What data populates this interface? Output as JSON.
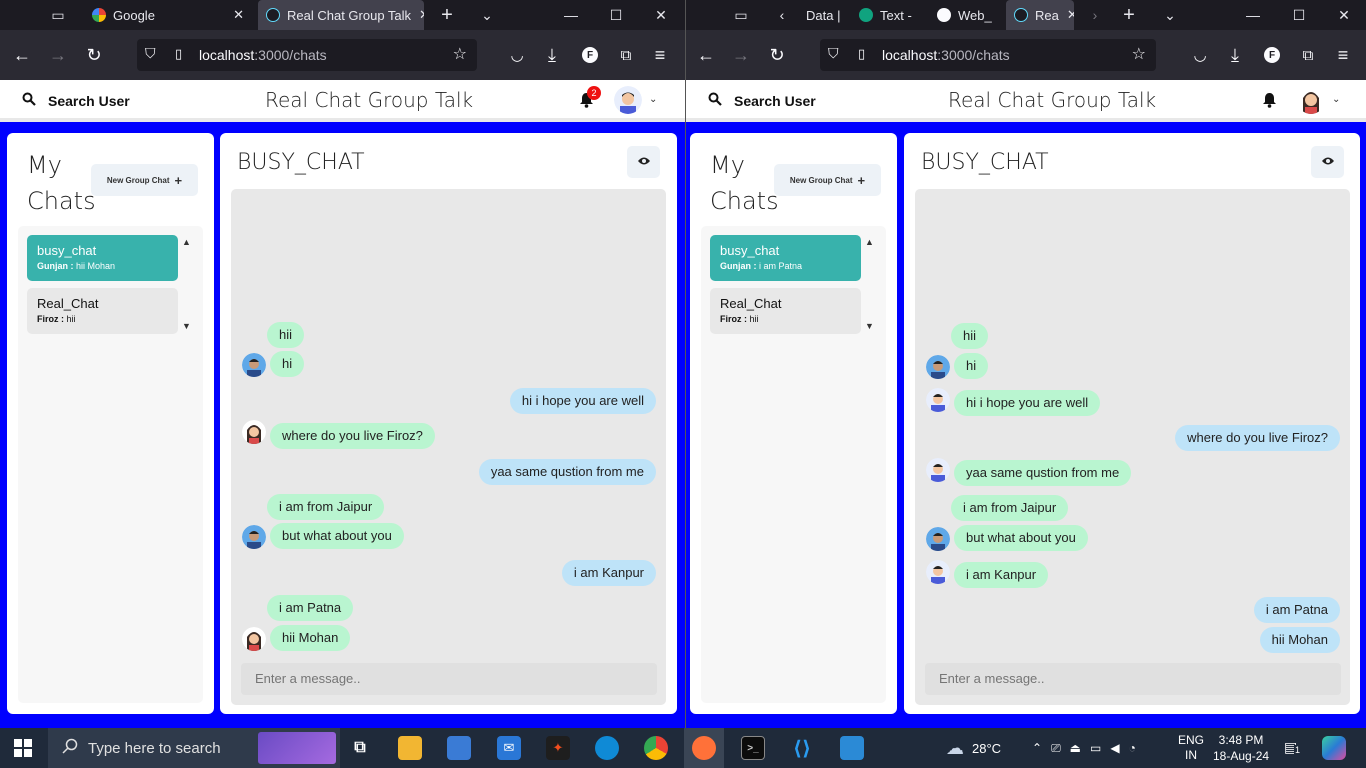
{
  "browser_left": {
    "tabs": [
      {
        "label": "Google",
        "active": false
      },
      {
        "label": "Real Chat Group Talk",
        "active": true
      }
    ],
    "url_host": "localhost",
    "url_path": ":3000/chats"
  },
  "browser_right": {
    "tabs": [
      {
        "label": "Data |",
        "active": false
      },
      {
        "label": "Text -",
        "active": false
      },
      {
        "label": "Web_",
        "active": false
      },
      {
        "label": "Rea",
        "active": true
      }
    ],
    "url_host": "localhost",
    "url_path": ":3000/chats"
  },
  "app": {
    "search_label": "Search User",
    "title": "Real Chat Group Talk",
    "notification_count": "2",
    "my_chats_title": "My Chats",
    "new_group_label": "New Group Chat",
    "input_placeholder": "Enter a message.."
  },
  "left": {
    "chats": [
      {
        "name": "busy_chat",
        "sender": "Gunjan :",
        "last": "hii Mohan",
        "active": true
      },
      {
        "name": "Real_Chat",
        "sender": "Firoz :",
        "last": "hii",
        "active": false
      }
    ],
    "chat_name": "BUSY_CHAT",
    "messages": [
      {
        "text": "hii",
        "dir": "in"
      },
      {
        "text": "hi",
        "dir": "in"
      },
      {
        "text": "hi i hope you are well",
        "dir": "out"
      },
      {
        "text": "where do you live Firoz?",
        "dir": "in"
      },
      {
        "text": "yaa same qustion from me",
        "dir": "out"
      },
      {
        "text": "i am from Jaipur",
        "dir": "in"
      },
      {
        "text": "but what about you",
        "dir": "in"
      },
      {
        "text": "i am Kanpur",
        "dir": "out"
      },
      {
        "text": "i am Patna",
        "dir": "in"
      },
      {
        "text": "hii Mohan",
        "dir": "in"
      }
    ]
  },
  "right": {
    "chats": [
      {
        "name": "busy_chat",
        "sender": "Gunjan :",
        "last": "i am Patna",
        "active": true
      },
      {
        "name": "Real_Chat",
        "sender": "Firoz :",
        "last": "hii",
        "active": false
      }
    ],
    "chat_name": "BUSY_CHAT",
    "messages": [
      {
        "text": "hii",
        "dir": "in"
      },
      {
        "text": "hi",
        "dir": "in"
      },
      {
        "text": "hi i hope you are well",
        "dir": "in"
      },
      {
        "text": "where do you live Firoz?",
        "dir": "out"
      },
      {
        "text": "yaa same qustion from me",
        "dir": "in"
      },
      {
        "text": "i am from Jaipur",
        "dir": "in"
      },
      {
        "text": "but what about you",
        "dir": "in"
      },
      {
        "text": "i am Kanpur",
        "dir": "in"
      },
      {
        "text": "i am Patna",
        "dir": "out"
      },
      {
        "text": "hii Mohan",
        "dir": "out"
      }
    ]
  },
  "taskbar": {
    "search_placeholder": "Type here to search",
    "weather": "28°C",
    "lang": "ENG",
    "region": "IN",
    "time": "3:48 PM",
    "date": "18-Aug-24",
    "notif_count": "1"
  },
  "colors": {
    "page_bg": "#0000ff",
    "active_chat": "#38b2ac",
    "incoming_bubble": "#b9f5d0",
    "outgoing_bubble": "#bee3f8"
  }
}
